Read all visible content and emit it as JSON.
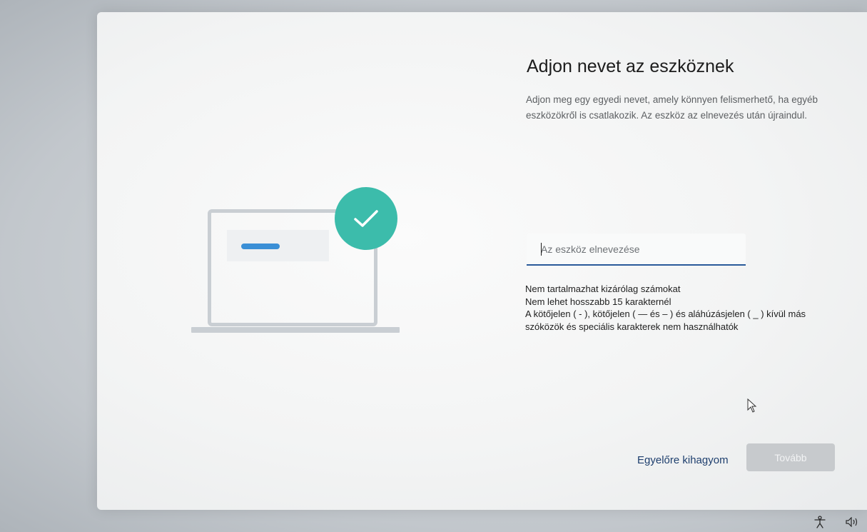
{
  "page": {
    "title": "Adjon nevet az eszköznek",
    "description": "Adjon meg egy egyedi nevet, amely könnyen felismerhető, ha egyéb eszközökről is csatlakozik. Az eszköz az elnevezés után újraindul."
  },
  "name_field": {
    "value": "",
    "placeholder": "Az eszköz elnevezése"
  },
  "rules": [
    "Nem tartalmazhat kizárólag számokat",
    "Nem lehet hosszabb 15 karakternél",
    "A kötőjelen ( - ), kötőjelen ( — és – ) és aláhúzásjelen ( _ ) kívül más szóközök és speciális karakterek nem használhatók"
  ],
  "actions": {
    "skip_label": "Egyelőre kihagyom",
    "next_label": "Tovább"
  },
  "icons": {
    "illustration": "laptop-with-checkmark",
    "cursor": "mouse-pointer-icon",
    "tray": [
      "accessibility-icon",
      "volume-icon"
    ]
  },
  "colors": {
    "accent": "#3a8fd6",
    "check_badge": "#3cbcab",
    "input_underline": "#2a5a9a",
    "disabled_button": "#c7cacd"
  }
}
